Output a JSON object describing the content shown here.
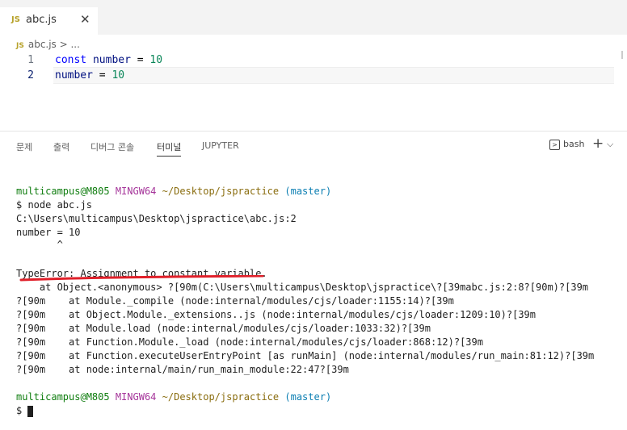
{
  "tab": {
    "icon": "JS",
    "filename": "abc.js",
    "close": "✕"
  },
  "breadcrumb": {
    "icon": "JS",
    "text": "abc.js > ..."
  },
  "editor": {
    "lines": [
      {
        "num": "1",
        "kw": "const",
        "var": "number",
        "op": " = ",
        "val": "10"
      },
      {
        "num": "2",
        "var": "number",
        "op": " = ",
        "val": "10"
      }
    ]
  },
  "panel": {
    "tabs": [
      "문제",
      "출력",
      "디버그 콘솔",
      "터미널",
      "JUPYTER"
    ],
    "shell": "bash",
    "plus": "+",
    "dropdown": "⌵"
  },
  "terminal": {
    "prompt1": {
      "user": "multicampus@M805",
      "env": "MINGW64",
      "path": "~/Desktop/jspractice",
      "branch": "(master)"
    },
    "cmd": "$ node abc.js",
    "path_line": "C:\\Users\\multicampus\\Desktop\\jspractice\\abc.js:2",
    "src_line": "number = 10",
    "caret": "       ^",
    "error": "TypeError: Assignment to constant variable.",
    "stack": [
      "    at Object.<anonymous> ?[90m(C:\\Users\\multicampus\\Desktop\\jspractice\\?[39mabc.js:2:8?[90m)?[39m",
      "?[90m    at Module._compile (node:internal/modules/cjs/loader:1155:14)?[39m",
      "?[90m    at Object.Module._extensions..js (node:internal/modules/cjs/loader:1209:10)?[39m",
      "?[90m    at Module.load (node:internal/modules/cjs/loader:1033:32)?[39m",
      "?[90m    at Function.Module._load (node:internal/modules/cjs/loader:868:12)?[39m",
      "?[90m    at Function.executeUserEntryPoint [as runMain] (node:internal/modules/run_main:81:12)?[39m",
      "?[90m    at node:internal/main/run_main_module:22:47?[39m"
    ],
    "prompt2": {
      "user": "multicampus@M805",
      "env": "MINGW64",
      "path": "~/Desktop/jspractice",
      "branch": "(master)"
    },
    "dollar": "$ "
  },
  "colors": {
    "annotation": "#e0202a"
  }
}
